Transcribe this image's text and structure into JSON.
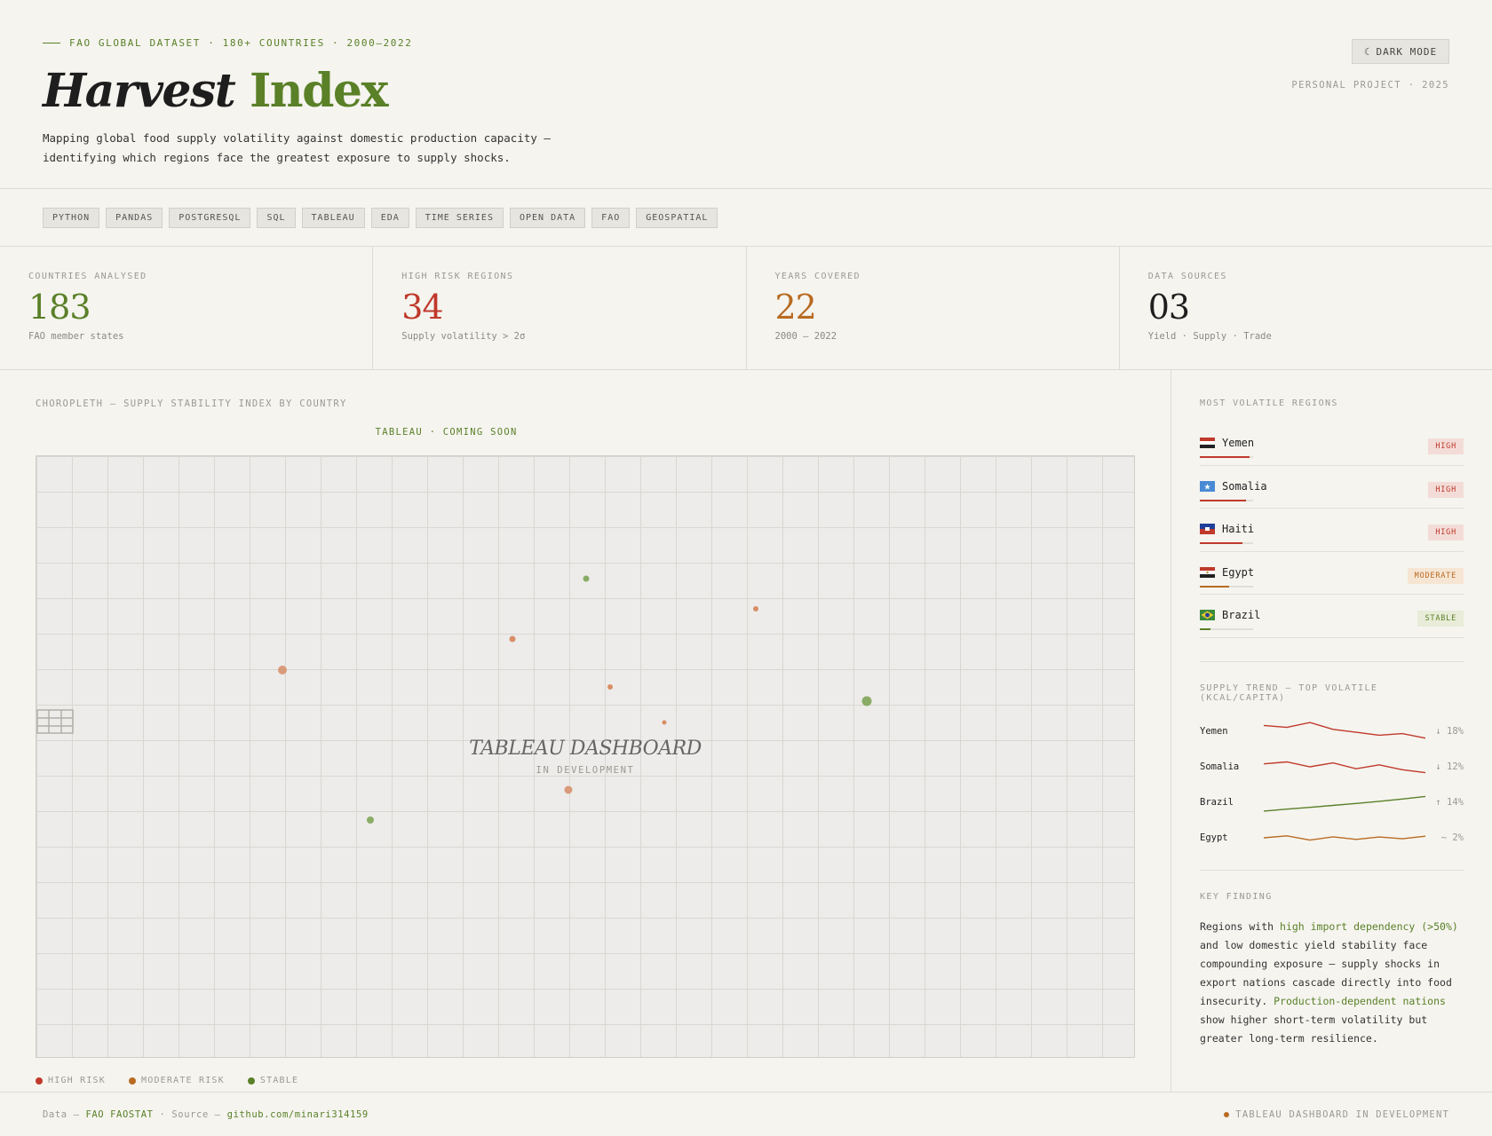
{
  "header": {
    "eyebrow": "FAO GLOBAL DATASET · 180+ COUNTRIES · 2000–2022",
    "title_part1": "Harvest",
    "title_part2": "Index",
    "subtitle": "Mapping global food supply volatility against domestic production capacity — identifying which regions face the greatest exposure to supply shocks.",
    "dark_mode_icon": "☾",
    "dark_mode_label": "DARK MODE",
    "project_note": "PERSONAL PROJECT · 2025"
  },
  "tags": [
    "PYTHON",
    "PANDAS",
    "POSTGRESQL",
    "SQL",
    "TABLEAU",
    "EDA",
    "TIME SERIES",
    "OPEN DATA",
    "FAO",
    "GEOSPATIAL"
  ],
  "stats": [
    {
      "label": "COUNTRIES ANALYSED",
      "value": "183",
      "sub": "FAO member states",
      "color": "#5a8028"
    },
    {
      "label": "HIGH RISK REGIONS",
      "value": "34",
      "sub": "Supply volatility > 2σ",
      "color": "#c0392b"
    },
    {
      "label": "YEARS COVERED",
      "value": "22",
      "sub": "2000 — 2022",
      "color": "#b86b22"
    },
    {
      "label": "DATA SOURCES",
      "value": "03",
      "sub": "Yield · Supply · Trade",
      "color": "#1e1e1e"
    }
  ],
  "map": {
    "section_label": "CHOROPLETH — SUPPLY STABILITY INDEX BY COUNTRY",
    "status_label": "TABLEAU · COMING SOON",
    "placeholder_icon": "table-icon",
    "placeholder_title": "TABLEAU DASHBOARD",
    "placeholder_sub": "IN DEVELOPMENT",
    "legend": [
      {
        "label": "HIGH RISK",
        "color": "#c0392b"
      },
      {
        "label": "MODERATE RISK",
        "color": "#b86b22"
      },
      {
        "label": "STABLE",
        "color": "#5a8028"
      }
    ]
  },
  "volatile": {
    "label": "MOST VOLATILE REGIONS",
    "items": [
      {
        "name": "Yemen",
        "badge": "HIGH",
        "level": "high",
        "score": 0.93,
        "flag": "yemen-flag-icon"
      },
      {
        "name": "Somalia",
        "badge": "HIGH",
        "level": "high",
        "score": 0.87,
        "flag": "somalia-flag-icon"
      },
      {
        "name": "Haiti",
        "badge": "HIGH",
        "level": "high",
        "score": 0.8,
        "flag": "haiti-flag-icon"
      },
      {
        "name": "Egypt",
        "badge": "MODERATE",
        "level": "moderate",
        "score": 0.55,
        "flag": "egypt-flag-icon"
      },
      {
        "name": "Brazil",
        "badge": "STABLE",
        "level": "stable",
        "score": 0.2,
        "flag": "brazil-flag-icon"
      }
    ]
  },
  "trend": {
    "label": "SUPPLY TREND — TOP VOLATILE (KCAL/CAPITA)",
    "rows": [
      {
        "name": "Yemen",
        "value": "↓ 18%",
        "color": "#c0392b",
        "points": [
          0.2,
          0.3,
          0.05,
          0.4,
          0.55,
          0.7,
          0.62,
          0.85
        ]
      },
      {
        "name": "Somalia",
        "value": "↓ 12%",
        "color": "#c0392b",
        "points": [
          0.35,
          0.25,
          0.5,
          0.3,
          0.6,
          0.4,
          0.65,
          0.8
        ]
      },
      {
        "name": "Brazil",
        "value": "↑ 14%",
        "color": "#5a8028",
        "points": [
          0.95,
          0.85,
          0.76,
          0.66,
          0.56,
          0.45,
          0.33,
          0.2
        ]
      },
      {
        "name": "Egypt",
        "value": "~ 2%",
        "color": "#b86b22",
        "points": [
          0.5,
          0.4,
          0.62,
          0.45,
          0.58,
          0.46,
          0.55,
          0.42
        ]
      }
    ]
  },
  "finding": {
    "label": "KEY FINDING",
    "p1": "Regions with ",
    "h1": "high import dependency (>50%)",
    "p2": " and low domestic yield stability face compounding exposure — supply shocks in export nations cascade directly into food insecurity. ",
    "h2": "Production-dependent nations",
    "p3": " show higher short-term volatility but greater long-term resilience."
  },
  "footer": {
    "data_prefix": "Data —",
    "data_link": "FAO FAOSTAT",
    "source_prefix": "· Source —",
    "source_link": "github.com/minari314159",
    "status": "TABLEAU DASHBOARD IN DEVELOPMENT"
  }
}
